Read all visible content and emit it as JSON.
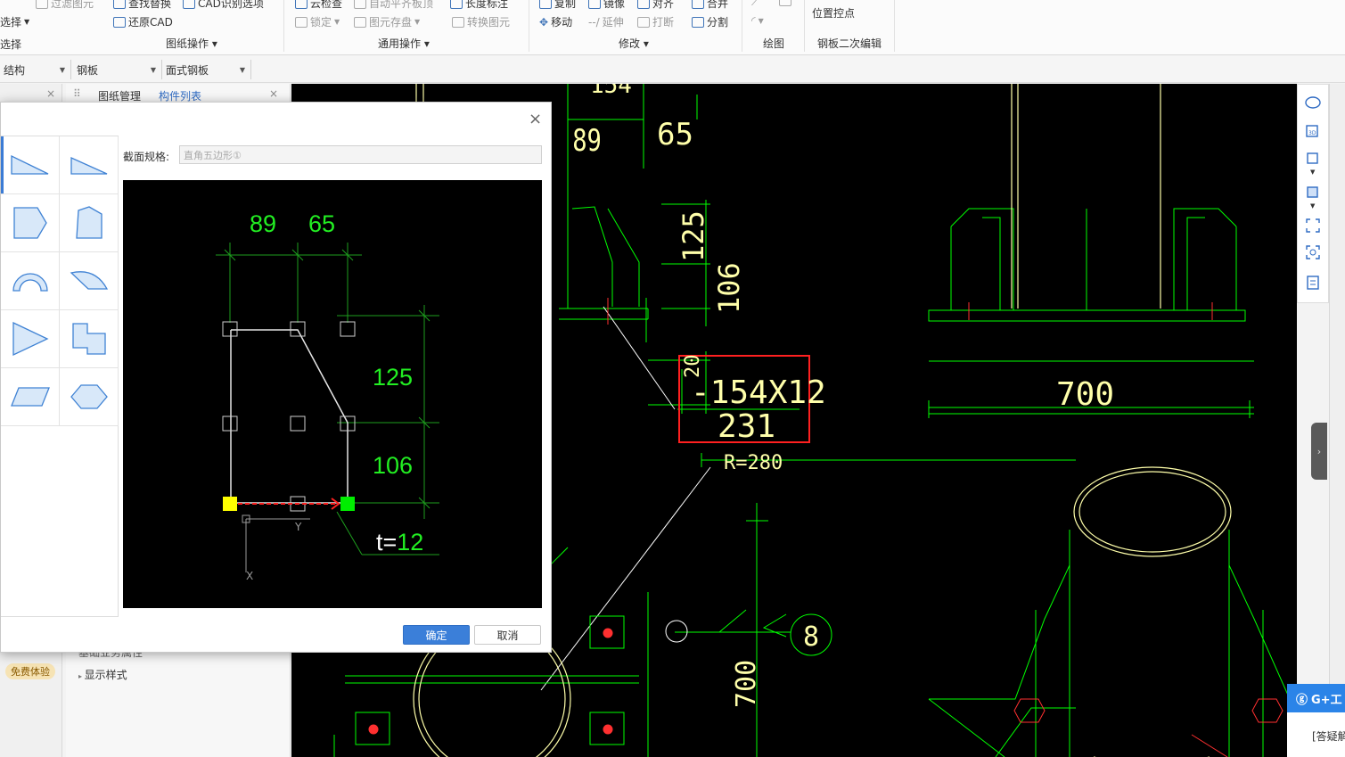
{
  "ribbon": {
    "items": [
      {
        "label": "过滤图元",
        "dim": true
      },
      {
        "label": "选择"
      },
      {
        "label": "选择"
      },
      {
        "label": "查找替换"
      },
      {
        "label": "CAD识别选项"
      },
      {
        "label": "还原CAD"
      },
      {
        "label": "云检查"
      },
      {
        "label": "自动平齐板顶",
        "dim": true
      },
      {
        "label": "长度标注"
      },
      {
        "label": "锁定",
        "dim": true
      },
      {
        "label": "图元存盘",
        "dim": true
      },
      {
        "label": "转换图元",
        "dim": true
      },
      {
        "label": "复制"
      },
      {
        "label": "镜像"
      },
      {
        "label": "对齐"
      },
      {
        "label": "合并"
      },
      {
        "label": "移动"
      },
      {
        "label": "延伸",
        "dim": true
      },
      {
        "label": "打断",
        "dim": true
      },
      {
        "label": "分割"
      },
      {
        "label": "位置控点"
      }
    ],
    "groups": {
      "drawing_ops": "图纸操作",
      "general_ops": "通用操作",
      "modify": "修改",
      "draw": "绘图",
      "plate_edit": "钢板二次编辑"
    }
  },
  "selectors": {
    "structure": "结构",
    "plate": "钢板",
    "face_plate": "面式钢板"
  },
  "panel": {
    "tab_drawing_mgmt": "图纸管理",
    "tab_component_list": "构件列表",
    "close": "×",
    "trial_badge": "免费体验",
    "tree_row_1": "基础业务属性",
    "tree_row_2": "显示样式"
  },
  "dialog": {
    "close": "×",
    "spec_label": "截面规格:",
    "spec_value": "直角五边形①",
    "ok": "确定",
    "cancel": "取消",
    "preview": {
      "dim_top_left": "89",
      "dim_top_right": "65",
      "dim_right_top": "125",
      "dim_right_bottom": "106",
      "thickness_prefix": "t=",
      "thickness_value": "12",
      "axis_y": "Y",
      "axis_x": "X"
    }
  },
  "cad": {
    "label_154": "154",
    "dim_89": "89",
    "dim_65": "65",
    "dim_125": "125",
    "dim_106": "106",
    "dim_20": "20",
    "plate_spec": "-154X12",
    "plate_len": "231",
    "dim_700": "700",
    "radius": "R=280",
    "weld_no": "8",
    "dim_700_v": "700"
  },
  "right": {
    "gplus": "G+工",
    "qa": "[答疑解"
  },
  "colors": {
    "cad_green": "#00ff00",
    "cad_yellow": "#ffffaa",
    "highlight_red": "#ff2020",
    "accent_blue": "#3b7fd9"
  }
}
